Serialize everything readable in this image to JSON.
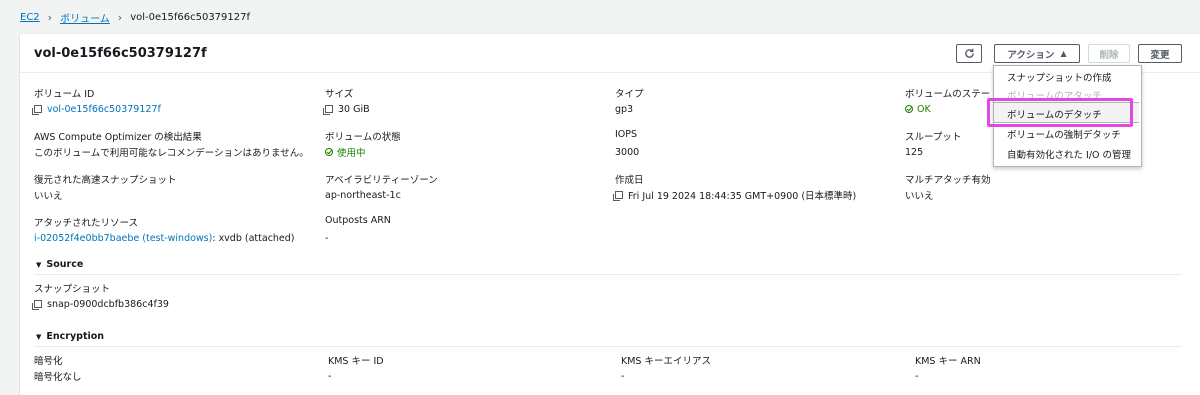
{
  "breadcrumb": {
    "root": "EC2",
    "parent": "ボリューム",
    "current": "vol-0e15f66c50379127f"
  },
  "header": {
    "title": "vol-0e15f66c50379127f",
    "actions_label": "アクション",
    "delete_label": "削除",
    "modify_label": "変更"
  },
  "details": {
    "volume_id_label": "ボリューム ID",
    "volume_id": "vol-0e15f66c50379127f",
    "size_label": "サイズ",
    "size": "30 GiB",
    "type_label": "タイプ",
    "type": "gp3",
    "volume_state_label": "ボリュームのステータス",
    "volume_state": "OK",
    "optimizer_label": "AWS Compute Optimizer の検出結果",
    "optimizer": "このボリュームで利用可能なレコメンデーションはありません。",
    "status_label": "ボリュームの状態",
    "status": "使用中",
    "iops_label": "IOPS",
    "iops": "3000",
    "throughput_label": "スループット",
    "throughput": "125",
    "fast_snapshot_label": "復元された高速スナップショット",
    "fast_snapshot": "いいえ",
    "az_label": "アベイラビリティーゾーン",
    "az": "ap-northeast-1c",
    "created_label": "作成日",
    "created": "Fri Jul 19 2024 18:44:35 GMT+0900 (日本標準時)",
    "multi_attach_label": "マルチアタッチ有効",
    "multi_attach": "いいえ",
    "attached_label": "アタッチされたリソース",
    "attached_link": "i-02052f4e0bb7baebe (test-windows)",
    "attached_rest": ": xvdb (attached)",
    "outposts_label": "Outposts ARN",
    "outposts": "-"
  },
  "source": {
    "title": "Source",
    "snapshot_label": "スナップショット",
    "snapshot": "snap-0900dcbfb386c4f39"
  },
  "encryption": {
    "title": "Encryption",
    "enc_label": "暗号化",
    "enc": "暗号化なし",
    "kms_id_label": "KMS キー ID",
    "kms_id": "-",
    "kms_alias_label": "KMS キーエイリアス",
    "kms_alias": "-",
    "kms_arn_label": "KMS キー ARN",
    "kms_arn": "-"
  },
  "menu": {
    "items": [
      "スナップショットの作成",
      "ボリュームのアタッチ",
      "ボリュームのデタッチ",
      "ボリュームの強制デタッチ",
      "自動有効化された I/O の管理"
    ]
  },
  "colors": {
    "link": "#0073bb",
    "success": "#1d8102",
    "highlight": "#e548e0"
  },
  "icons": [
    "refresh-icon",
    "caret-up-icon",
    "copy-icon",
    "success-icon",
    "triangle-down-icon"
  ]
}
